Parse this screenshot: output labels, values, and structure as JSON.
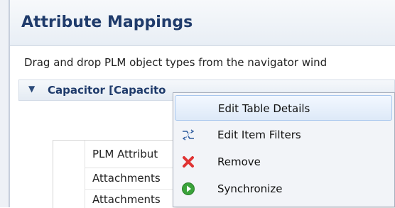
{
  "page": {
    "title": "Attribute Mappings",
    "description": "Drag and drop PLM object types from the navigator wind"
  },
  "section": {
    "title": "Capacitor [Capacito"
  },
  "table": {
    "header": "PLM Attribut",
    "rows": [
      "Attachments",
      "Attachments"
    ]
  },
  "context_menu": {
    "items": [
      {
        "label": "Edit Table Details",
        "icon": "none",
        "highlighted": true
      },
      {
        "label": "Edit Item Filters",
        "icon": "filter-icon"
      },
      {
        "label": "Remove",
        "icon": "remove-icon"
      },
      {
        "label": "Synchronize",
        "icon": "synchronize-icon"
      }
    ]
  },
  "colors": {
    "title": "#1f3b6b",
    "remove": "#e03333",
    "synchronize": "#3aa33a",
    "filter": "#2f5c9c"
  }
}
